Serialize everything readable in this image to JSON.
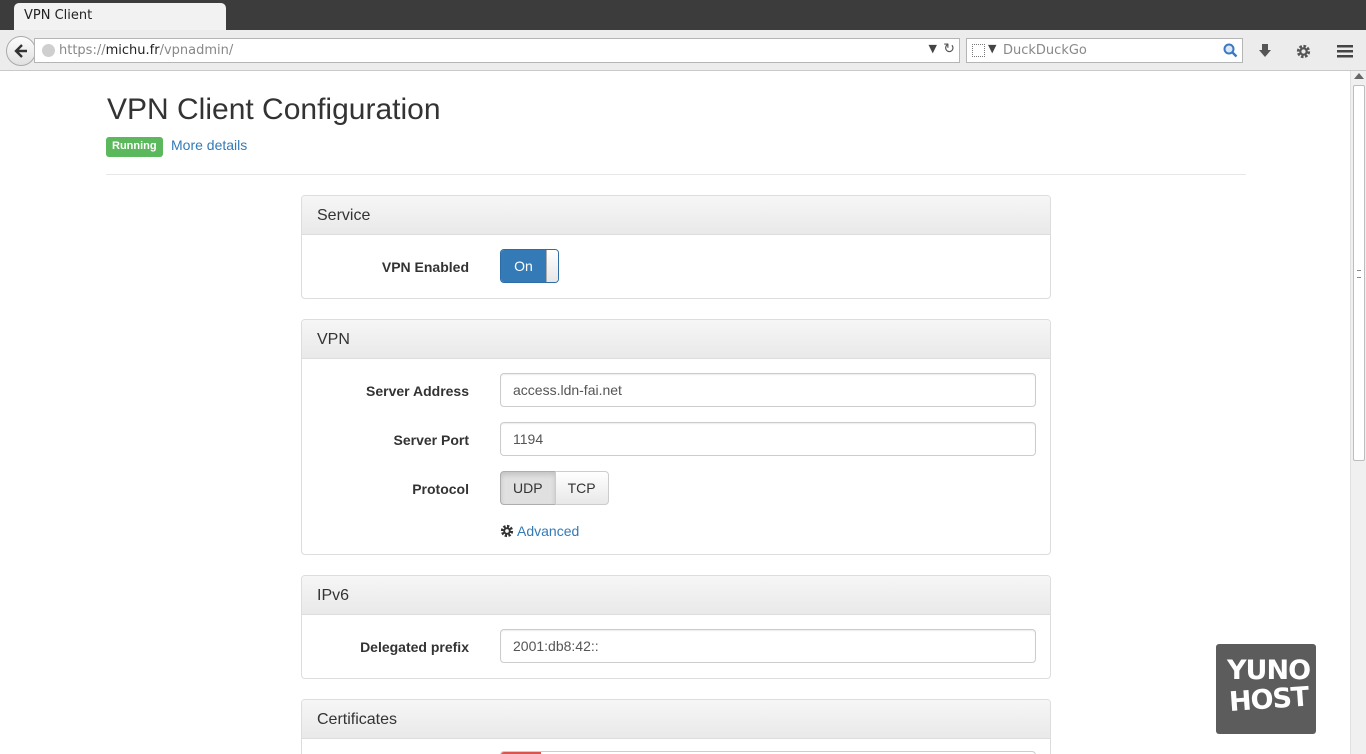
{
  "browser": {
    "tab_title": "VPN Client",
    "url_prefix": "https://",
    "url_host": "michu.fr",
    "url_path": "/vpnadmin/",
    "search_placeholder": "DuckDuckGo"
  },
  "page": {
    "title": "VPN Client Configuration",
    "status": "Running",
    "more_details": "More details"
  },
  "service": {
    "heading": "Service",
    "vpn_enabled_label": "VPN Enabled",
    "switch_state": "On"
  },
  "vpn": {
    "heading": "VPN",
    "server_address_label": "Server Address",
    "server_address_value": "access.ldn-fai.net",
    "server_port_label": "Server Port",
    "server_port_value": "1194",
    "protocol_label": "Protocol",
    "protocol_options": [
      "UDP",
      "TCP"
    ],
    "protocol_selected": "UDP",
    "advanced_label": "Advanced"
  },
  "ipv6": {
    "heading": "IPv6",
    "delegated_prefix_label": "Delegated prefix",
    "delegated_prefix_value": "2001:db8:42::"
  },
  "certificates": {
    "heading": "Certificates"
  },
  "logo": {
    "line1": "YUNO",
    "line2": "HOST"
  },
  "colors": {
    "accent": "#337ab7",
    "success": "#5cb85c",
    "logo_bg": "#5c5c5c"
  }
}
